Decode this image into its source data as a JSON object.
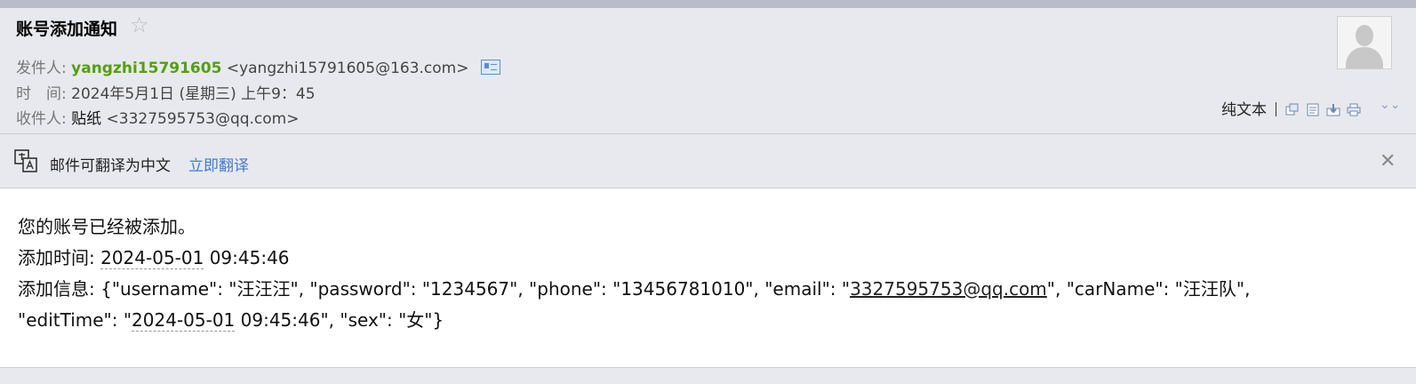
{
  "email": {
    "subject": "账号添加通知",
    "sender_label": "发件人:",
    "sender_name": "yangzhi15791605",
    "sender_address": "<yangzhi15791605@163.com>",
    "time_label": "时　间:",
    "time_value": "2024年5月1日 (星期三) 上午9：45",
    "recipient_label": "收件人:",
    "recipient_name": "贴纸",
    "recipient_address": "<3327595753@qq.com>"
  },
  "toolbar": {
    "plain_text": "纯文本",
    "icons": [
      "new-window-icon",
      "print-preview-icon",
      "download-icon",
      "print-icon",
      "more-chevron-icon"
    ]
  },
  "translate": {
    "message": "邮件可翻译为中文",
    "action": "立即翻译"
  },
  "body": {
    "line1": "您的账号已经被添加。",
    "line2_label": "添加时间: ",
    "line2_date": "2024-05-01",
    "line2_time": " 09:45:46",
    "line3_prefix": "添加信息: {\"username\": \"汪汪汪\", \"password\": \"1234567\", \"phone\": \"13456781010\", \"email\": \"",
    "line3_email": "3327595753@qq.com",
    "line3_suffix": "\", \"carName\": \"汪汪队\",",
    "line4_prefix": "\"editTime\": \"",
    "line4_date": "2024-05-01",
    "line4_suffix": " 09:45:46\", \"sex\": \"女\"}"
  },
  "colors": {
    "sender_green": "#52a10b",
    "link_blue": "#3d7bd3",
    "header_bg": "#e8e9ef"
  }
}
